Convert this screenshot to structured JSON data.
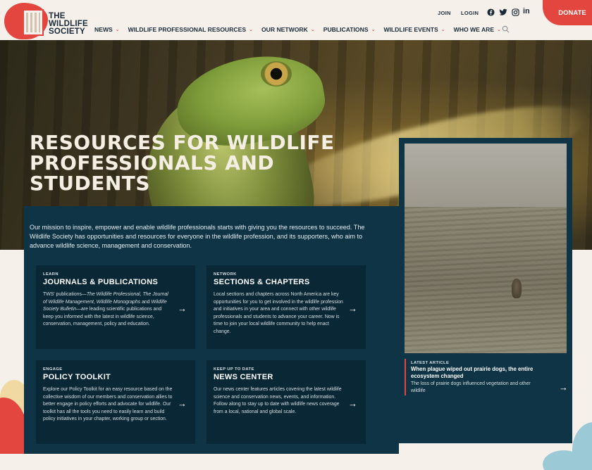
{
  "brand": {
    "logo_lines": [
      "THE",
      "WILDLIFE",
      "SOCIETY"
    ]
  },
  "utility_nav": {
    "join": "JOIN",
    "login": "LOGIN",
    "donate": "DONATE",
    "social": [
      {
        "icon": "facebook-icon",
        "glyph": "f"
      },
      {
        "icon": "twitter-icon",
        "glyph": "t"
      },
      {
        "icon": "instagram-icon",
        "glyph": "ig"
      },
      {
        "icon": "linkedin-icon",
        "glyph": "in"
      }
    ]
  },
  "main_nav": [
    {
      "label": "NEWS"
    },
    {
      "label": "WILDLIFE PROFESSIONAL RESOURCES"
    },
    {
      "label": "OUR NETWORK"
    },
    {
      "label": "PUBLICATIONS"
    },
    {
      "label": "WILDLIFE EVENTS"
    },
    {
      "label": "WHO WE ARE"
    }
  ],
  "hero": {
    "title": "RESOURCES FOR WILDLIFE PROFESSIONALS AND STUDENTS",
    "mission": "Our mission to inspire, empower and enable wildlife professionals starts with giving you the resources to succeed. The Wildlife Society has opportunities and resources for everyone in the wildlife profession, and its supporters, who aim to advance wildlife science, management and conservation."
  },
  "cards": [
    {
      "eyebrow": "LEARN",
      "title": "JOURNALS & PUBLICATIONS",
      "body_html": "TWS' publications—<i>The Wildlife Professional</i>, <i>The Journal of Wildlife Management</i>, <i>Wildlife Monographs</i> and <i>Wildlife Society Bulletin</i>—are leading scientific publications and keep you informed with the latest in wildlife science, conservation, management, policy and education."
    },
    {
      "eyebrow": "NETWORK",
      "title": "SECTIONS & CHAPTERS",
      "body": "Local sections and chapters across North America are key opportunities for you to get involved in the wildlife profession and initiatives in your area and connect with other wildlife professionals and students to advance your career. Now is time to join your local wildlife community to help enact change."
    },
    {
      "eyebrow": "ENGAGE",
      "title": "POLICY TOOLKIT",
      "body": "Explore our Policy Toolkit for an easy resource based on the collective wisdom of our members and conservation allies to better engage in policy efforts and advocate for wildlife. Our toolkit has all the tools you need to easily learn and build policy initiatives in your chapter, working group or section."
    },
    {
      "eyebrow": "KEEP UP TO DATE",
      "title": "NEWS CENTER",
      "body": "Our news center features articles covering the latest wildlife science and conservation news, events, and information. Follow along to stay up to date with wildlife news coverage from a local, national and global scale."
    }
  ],
  "latest_article": {
    "eyebrow": "LATEST ARTICLE",
    "headline": "When plague wiped out prairie dogs, the entire ecosystem changed",
    "summary": "The loss of prairie dogs influenced vegetation and other wildlife"
  },
  "colors": {
    "accent": "#e2463f",
    "navy": "#0f3446",
    "card": "#0a2736",
    "cream": "#f5f1ea"
  }
}
